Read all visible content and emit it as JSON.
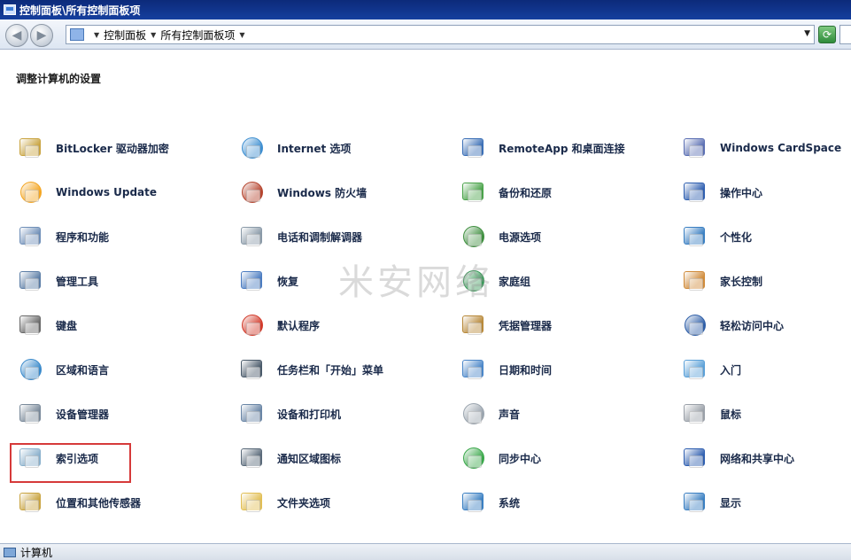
{
  "window": {
    "title": "控制面板\\所有控制面板项"
  },
  "navbar": {
    "back_label": "◀",
    "forward_label": "▶",
    "breadcrumb": [
      "控制面板",
      "所有控制面板项"
    ],
    "dropdown_label": "▼",
    "refresh_label": "⟳"
  },
  "main": {
    "title": "调整计算机的设置",
    "watermark": "米安网络",
    "items": [
      {
        "label": "BitLocker 驱动器加密",
        "icon": "bitlocker-key-icon",
        "color": "#c9a441"
      },
      {
        "label": "Internet 选项",
        "icon": "globe-checklist-icon",
        "color": "#3e8fd1"
      },
      {
        "label": "RemoteApp 和桌面连接",
        "icon": "remote-desktop-icon",
        "color": "#3b6fb6"
      },
      {
        "label": "Windows CardSpace",
        "icon": "cardspace-icon",
        "color": "#5b6fb3"
      },
      {
        "label": "Windows Update",
        "icon": "windows-update-icon",
        "color": "#f4a623"
      },
      {
        "label": "Windows 防火墙",
        "icon": "firewall-icon",
        "color": "#b5442e"
      },
      {
        "label": "备份和还原",
        "icon": "backup-restore-icon",
        "color": "#4aa34a"
      },
      {
        "label": "操作中心",
        "icon": "action-center-flag-icon",
        "color": "#2f5fb0"
      },
      {
        "label": "程序和功能",
        "icon": "programs-icon",
        "color": "#6f8fb8"
      },
      {
        "label": "电话和调制解调器",
        "icon": "phone-modem-icon",
        "color": "#8a9aa8"
      },
      {
        "label": "电源选项",
        "icon": "power-options-icon",
        "color": "#3f8f3f"
      },
      {
        "label": "个性化",
        "icon": "personalization-icon",
        "color": "#3a7fc2"
      },
      {
        "label": "管理工具",
        "icon": "admin-tools-icon",
        "color": "#5c7ea6"
      },
      {
        "label": "恢复",
        "icon": "recovery-icon",
        "color": "#4b7cc1"
      },
      {
        "label": "家庭组",
        "icon": "homegroup-icon",
        "color": "#3b9a5a"
      },
      {
        "label": "家长控制",
        "icon": "parental-controls-icon",
        "color": "#d08b3a"
      },
      {
        "label": "键盘",
        "icon": "keyboard-icon",
        "color": "#6a6a6a"
      },
      {
        "label": "默认程序",
        "icon": "default-programs-icon",
        "color": "#d23b2b"
      },
      {
        "label": "凭据管理器",
        "icon": "credential-manager-icon",
        "color": "#b8893a"
      },
      {
        "label": "轻松访问中心",
        "icon": "ease-of-access-icon",
        "color": "#2f5fa8"
      },
      {
        "label": "区域和语言",
        "icon": "region-language-icon",
        "color": "#3a8acb"
      },
      {
        "label": "任务栏和「开始」菜单",
        "icon": "taskbar-start-icon",
        "color": "#4a5a6a"
      },
      {
        "label": "日期和时间",
        "icon": "date-time-icon",
        "color": "#4a86c8"
      },
      {
        "label": "入门",
        "icon": "getting-started-icon",
        "color": "#5aa0d8"
      },
      {
        "label": "设备管理器",
        "icon": "device-manager-icon",
        "color": "#7a8a9a"
      },
      {
        "label": "设备和打印机",
        "icon": "devices-printers-icon",
        "color": "#6a86a6"
      },
      {
        "label": "声音",
        "icon": "sound-speaker-icon",
        "color": "#9aa4ae"
      },
      {
        "label": "鼠标",
        "icon": "mouse-icon",
        "color": "#9aa0a8"
      },
      {
        "label": "索引选项",
        "icon": "indexing-options-icon",
        "color": "#8ab0cc"
      },
      {
        "label": "通知区域图标",
        "icon": "notification-area-icon",
        "color": "#5a6a7a"
      },
      {
        "label": "同步中心",
        "icon": "sync-center-icon",
        "color": "#3aa84a"
      },
      {
        "label": "网络和共享中心",
        "icon": "network-sharing-icon",
        "color": "#2f5fb0"
      },
      {
        "label": "位置和其他传感器",
        "icon": "location-sensors-icon",
        "color": "#c9a441"
      },
      {
        "label": "文件夹选项",
        "icon": "folder-options-icon",
        "color": "#e2bf55"
      },
      {
        "label": "系统",
        "icon": "system-icon",
        "color": "#3a7fc2"
      },
      {
        "label": "显示",
        "icon": "display-icon",
        "color": "#3a7fc2"
      }
    ]
  },
  "statusbar": {
    "text": "计算机"
  }
}
